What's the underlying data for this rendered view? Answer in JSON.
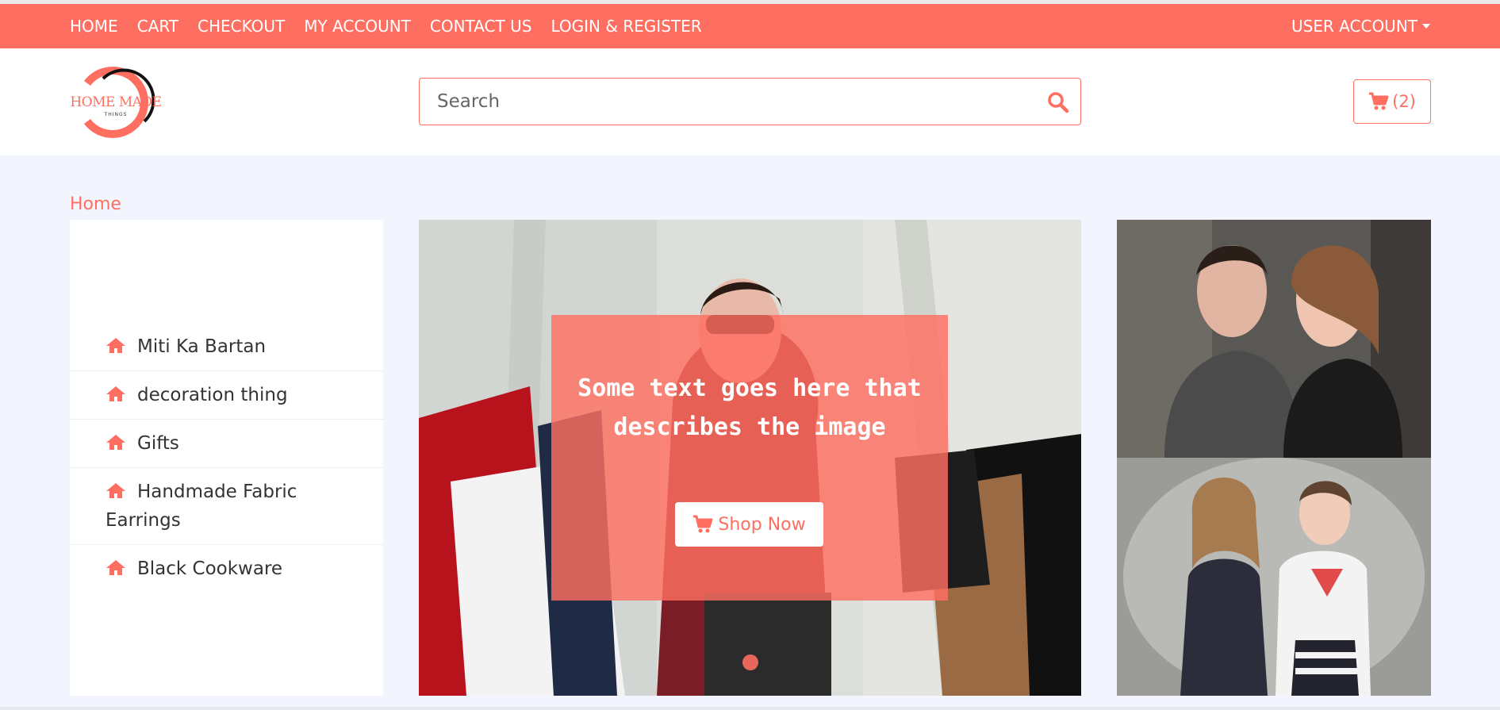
{
  "nav": {
    "links": [
      "HOME",
      "CART",
      "CHECKOUT",
      "MY ACCOUNT",
      "CONTACT US",
      "LOGIN & REGISTER"
    ],
    "user_account": "USER ACCOUNT"
  },
  "brand": {
    "logo_text": "HOME MADE",
    "logo_subtext": "THINGS"
  },
  "search": {
    "placeholder": "Search"
  },
  "cart": {
    "count": "(2)"
  },
  "breadcrumb": "Home",
  "sidebar": {
    "items": [
      {
        "label": "Miti Ka Bartan"
      },
      {
        "label": "decoration thing"
      },
      {
        "label": "Gifts"
      },
      {
        "label": "Handmade Fabric Earrings"
      },
      {
        "label": "Black Cookware"
      }
    ]
  },
  "hero": {
    "caption": "Some text goes here that describes the image",
    "button_label": "Shop Now"
  },
  "colors": {
    "accent": "#ff6f61",
    "page_bg": "#f2f5fd"
  },
  "icons": [
    "search-icon",
    "cart-icon",
    "home-icon",
    "chevron-down-icon"
  ]
}
